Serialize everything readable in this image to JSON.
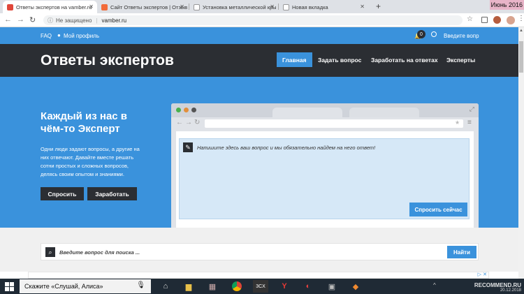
{
  "browser": {
    "tabs": [
      {
        "title": "Ответы экспертов на vamber.ru",
        "favicon_color": "#e0473a"
      },
      {
        "title": "Сайт Ответы экспертов | Отзыв",
        "favicon_color": "#f26b3a"
      },
      {
        "title": "Установка металлической кры",
        "favicon_color": "#e8e8e8"
      },
      {
        "title": "Новая вкладка",
        "favicon_color": "#e8e8e8"
      }
    ],
    "new_tab": "+",
    "window_title_fragment": "Июнь 2016",
    "security_label": "Не защищено",
    "url": "vamber.ru"
  },
  "site": {
    "top": {
      "faq": "FAQ",
      "profile": "Мой профиль",
      "notif_count": "0",
      "search_placeholder": "Введите вопр"
    },
    "logo": "Ответы экспертов",
    "nav": [
      "Главная",
      "Задать вопрос",
      "Заработать на ответах",
      "Эксперты"
    ],
    "hero": {
      "title": "Каждый из нас в чём-то Эксперт",
      "text": "Одни люди задают вопросы, а другие на них отвечают. Давайте вместе решать сотни простых и сложных вопросов, делясь своим опытом и знаниями.",
      "ask_button": "Спросить",
      "earn_button": "Заработать"
    },
    "ask": {
      "placeholder": "Напишите здесь ваш вопрос и мы обязательно найдем на него ответ!",
      "button": "Спросить сейчас"
    },
    "search": {
      "placeholder": "Введите вопрос для поиска ...",
      "button": "Найти"
    }
  },
  "taskbar": {
    "search_text": "Скажите «Слушай, Алиса»",
    "watermark": "RECOMMEND.RU",
    "date": "20.12.2018"
  },
  "colors": {
    "accent": "#3a92dc",
    "dark": "#2b2e33",
    "taskbar": "#1f2a35"
  }
}
